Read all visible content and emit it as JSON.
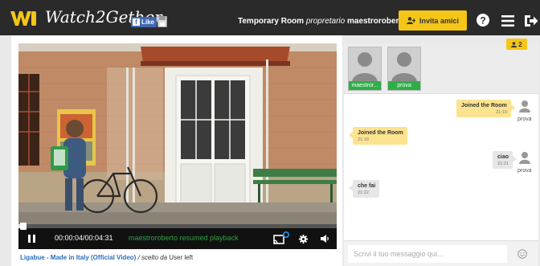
{
  "header": {
    "brand": "Watch2Gether",
    "fb_like": "Like",
    "room_name": "Temporary Room",
    "owner_prefix": "propretario",
    "owner": "maestroroberto",
    "invite_label": "Invita amici"
  },
  "player": {
    "time": "00:00:04/00:04:31",
    "status": "maestroroberto resumed playback",
    "progress": 0.015,
    "video_title": "Ligabue - Made in Italy (Official Video)",
    "chosen_by_prefix": "/ scelto da",
    "chosen_by": "User left"
  },
  "users": {
    "count": "2",
    "list": [
      {
        "name": "maestror..."
      },
      {
        "name": "prova"
      }
    ]
  },
  "chat": {
    "messages": [
      {
        "text": "Joined the Room",
        "time": "21:19",
        "user": "prova",
        "side": "right"
      },
      {
        "text": "Joined the Room",
        "time": "21:19",
        "side": "left"
      },
      {
        "text": "ciao",
        "time": "21:21",
        "user": "prova",
        "side": "right"
      },
      {
        "text": "che fai",
        "time": "21:22",
        "side": "left"
      }
    ],
    "placeholder": "Scrivi il tuo messaggio qui..."
  },
  "colors": {
    "accent": "#f5c518",
    "online": "#2fae48",
    "status_green": "#2ea044"
  }
}
